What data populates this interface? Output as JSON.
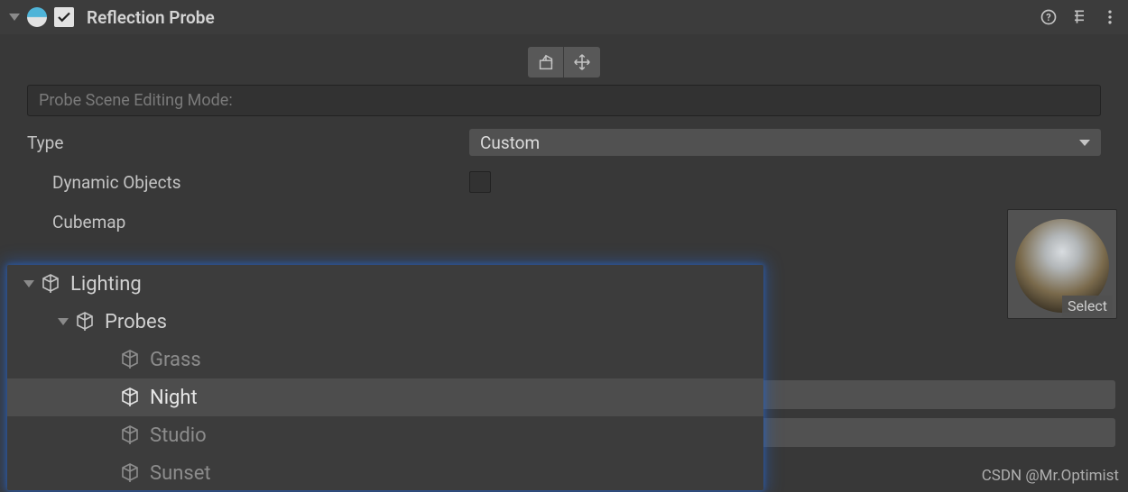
{
  "header": {
    "title": "Reflection Probe",
    "enabled": true
  },
  "mode_label": "Probe Scene Editing Mode:",
  "fields": {
    "type_label": "Type",
    "type_value": "Custom",
    "dynamic_objects_label": "Dynamic Objects",
    "cubemap_label": "Cubemap"
  },
  "cubemap": {
    "select_label": "Select"
  },
  "hierarchy": {
    "root": "Lighting",
    "group": "Probes",
    "items": [
      "Grass",
      "Night",
      "Studio",
      "Sunset"
    ],
    "selected_index": 1
  },
  "watermark": "CSDN @Mr.Optimist"
}
